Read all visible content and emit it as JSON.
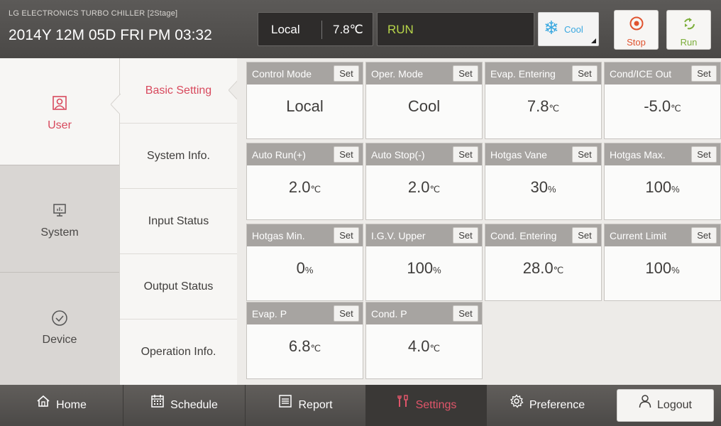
{
  "header": {
    "subtitle": "LG ELECTRONICS TURBO CHILLER [2Stage]",
    "datetime": "2014Y 12M 05D  FRI PM 03:32",
    "control_mode": "Local",
    "temperature": "7.8℃",
    "status": "RUN",
    "oper_mode": "Cool",
    "stop_label": "Stop",
    "run_label": "Run"
  },
  "nav": {
    "items": [
      {
        "label": "User",
        "icon": "user-icon"
      },
      {
        "label": "System",
        "icon": "monitor-icon"
      },
      {
        "label": "Device",
        "icon": "check-circle-icon"
      }
    ]
  },
  "subnav": {
    "items": [
      {
        "label": "Basic Setting"
      },
      {
        "label": "System Info."
      },
      {
        "label": "Input Status"
      },
      {
        "label": "Output Status"
      },
      {
        "label": "Operation Info."
      }
    ]
  },
  "set_label": "Set",
  "cards": [
    {
      "title": "Control Mode",
      "value": "Local",
      "unit": ""
    },
    {
      "title": "Oper. Mode",
      "value": "Cool",
      "unit": ""
    },
    {
      "title": "Evap. Entering",
      "value": "7.8",
      "unit": "℃"
    },
    {
      "title": "Cond/ICE Out",
      "value": "-5.0",
      "unit": "℃"
    },
    {
      "title": "Auto Run(+)",
      "value": "2.0",
      "unit": "℃"
    },
    {
      "title": "Auto Stop(-)",
      "value": "2.0",
      "unit": "℃"
    },
    {
      "title": "Hotgas Vane",
      "value": "30",
      "unit": "%"
    },
    {
      "title": "Hotgas Max.",
      "value": "100",
      "unit": "%"
    },
    {
      "title": "Hotgas Min.",
      "value": "0",
      "unit": "%"
    },
    {
      "title": "I.G.V. Upper",
      "value": "100",
      "unit": "%"
    },
    {
      "title": "Cond. Entering",
      "value": "28.0",
      "unit": "℃"
    },
    {
      "title": "Current Limit",
      "value": "100",
      "unit": "%"
    },
    {
      "title": "Evap. P",
      "value": "6.8",
      "unit": "℃"
    },
    {
      "title": "Cond. P",
      "value": "4.0",
      "unit": "℃"
    }
  ],
  "bottom": {
    "home": "Home",
    "schedule": "Schedule",
    "report": "Report",
    "settings": "Settings",
    "preference": "Preference",
    "logout": "Logout"
  },
  "colors": {
    "accent": "#d8495d",
    "run_green": "#b8d64a",
    "cool_blue": "#3aa8e0",
    "stop_orange": "#e0532e"
  }
}
